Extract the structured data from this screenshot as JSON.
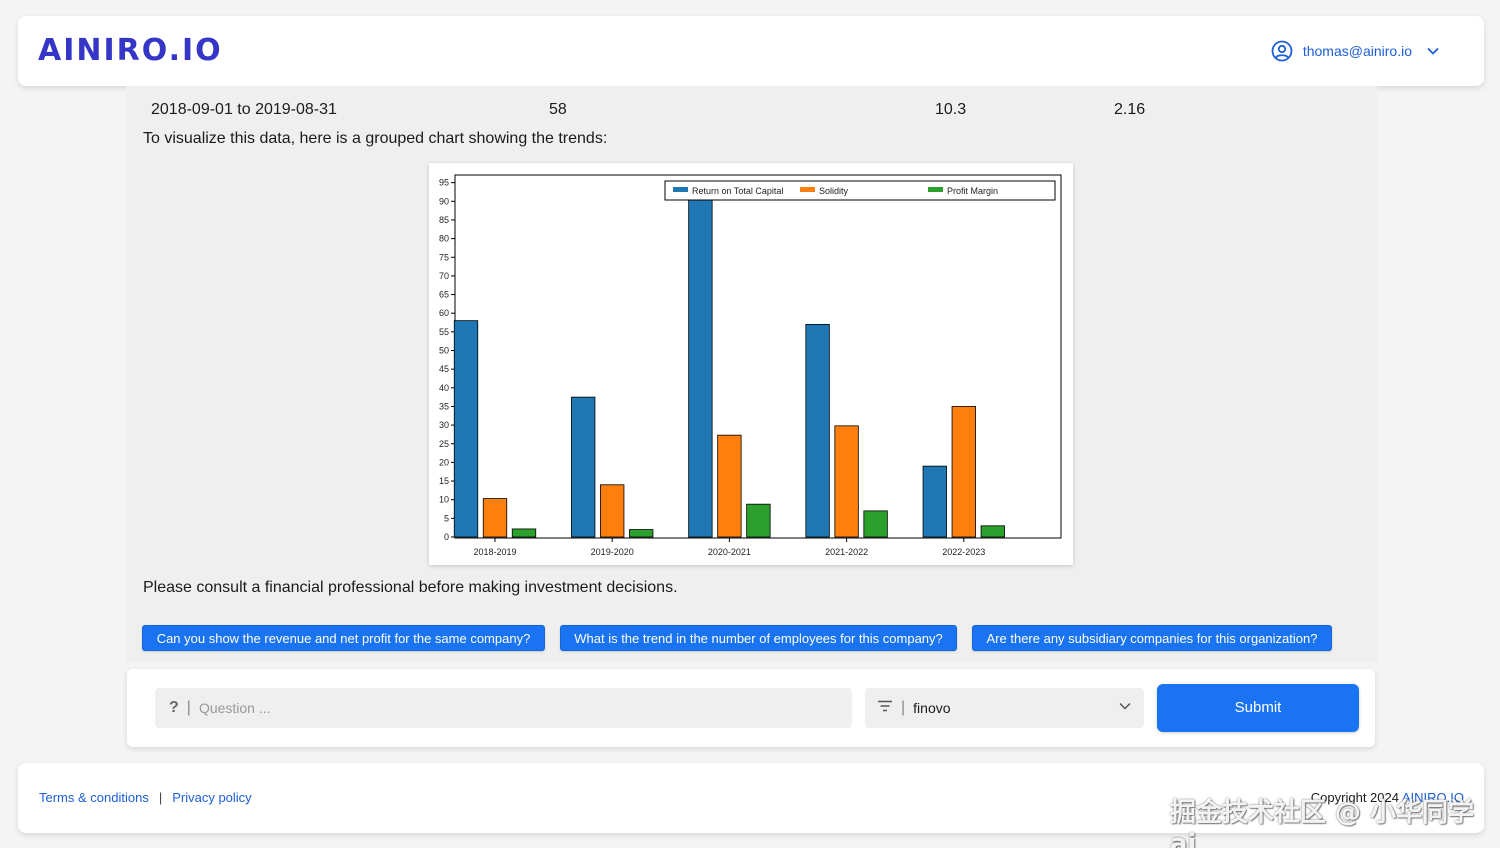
{
  "header": {
    "logo": "AINIRO.IO",
    "user_email": "thomas@ainiro.io",
    "icons": {
      "user": "user-circle-icon",
      "dropdown": "chevron-down-icon"
    }
  },
  "chat": {
    "table_row": {
      "period": "2018-09-01 to 2019-08-31",
      "col2": "58",
      "col3": "10.3",
      "col4": "2.16"
    },
    "intro": "To visualize this data, here is a grouped chart showing the trends:",
    "disclaimer": "Please consult a financial professional before making investment decisions."
  },
  "chart_data": {
    "type": "bar",
    "categories": [
      "2018-2019",
      "2019-2020",
      "2020-2021",
      "2021-2022",
      "2022-2023"
    ],
    "series": [
      {
        "name": "Return on Total Capital",
        "color": "#1f77b4",
        "values": [
          58,
          37.5,
          93,
          57,
          19
        ]
      },
      {
        "name": "Solidity",
        "color": "#ff7f0e",
        "values": [
          10.3,
          14,
          27.3,
          29.8,
          35
        ]
      },
      {
        "name": "Profit Margin",
        "color": "#2ca02c",
        "values": [
          2.16,
          2,
          8.8,
          7,
          3
        ]
      }
    ],
    "yticks": [
      0,
      5,
      10,
      15,
      20,
      25,
      30,
      35,
      40,
      45,
      50,
      55,
      60,
      65,
      70,
      75,
      80,
      85,
      90,
      95
    ],
    "ylim": [
      0,
      97
    ],
    "legend": "top-right",
    "grid": false
  },
  "suggestions": [
    "Can you show the revenue and net profit for the same company?",
    "What is the trend in the number of employees for this company?",
    "Are there any subsidiary companies for this organization?"
  ],
  "ask": {
    "question_icon": "?",
    "question_placeholder": "Question ...",
    "select_value": "finovo",
    "submit_label": "Submit"
  },
  "footer": {
    "terms": "Terms & conditions",
    "privacy": "Privacy policy",
    "copyright": "Copyright 2024",
    "copyright_link": "AINIRO.IO",
    "watermark": "掘金技术社区 @ 小华同学ai"
  }
}
